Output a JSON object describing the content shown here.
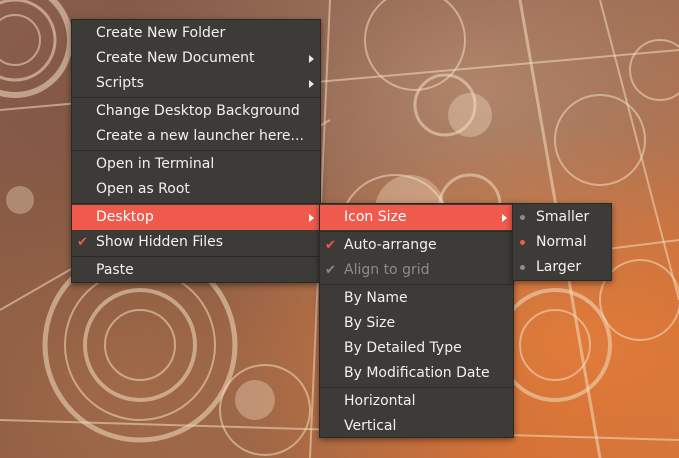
{
  "main_menu": {
    "items": [
      {
        "label": "Create New Folder"
      },
      {
        "label": "Create New Document"
      },
      {
        "label": "Scripts"
      },
      {
        "label": "Change Desktop Background"
      },
      {
        "label": "Create a new launcher here..."
      },
      {
        "label": "Open in Terminal"
      },
      {
        "label": "Open as Root"
      },
      {
        "label": "Desktop"
      },
      {
        "label": "Show Hidden Files",
        "checked": true
      },
      {
        "label": "Paste"
      }
    ]
  },
  "desktop_menu": {
    "items": [
      {
        "label": "Icon Size"
      },
      {
        "label": "Auto-arrange",
        "checked": true
      },
      {
        "label": "Align to grid",
        "checked": true,
        "disabled": true
      },
      {
        "label": "By Name"
      },
      {
        "label": "By Size"
      },
      {
        "label": "By Detailed Type"
      },
      {
        "label": "By Modification Date"
      },
      {
        "label": "Horizontal"
      },
      {
        "label": "Vertical"
      }
    ]
  },
  "icon_size_menu": {
    "items": [
      {
        "label": "Smaller"
      },
      {
        "label": "Normal",
        "selected": true
      },
      {
        "label": "Larger"
      }
    ]
  },
  "colors": {
    "menu_bg": "#3c3b37",
    "highlight": "#f05a4d",
    "text": "#f2f1f0",
    "disabled_text": "#8d8b87"
  }
}
